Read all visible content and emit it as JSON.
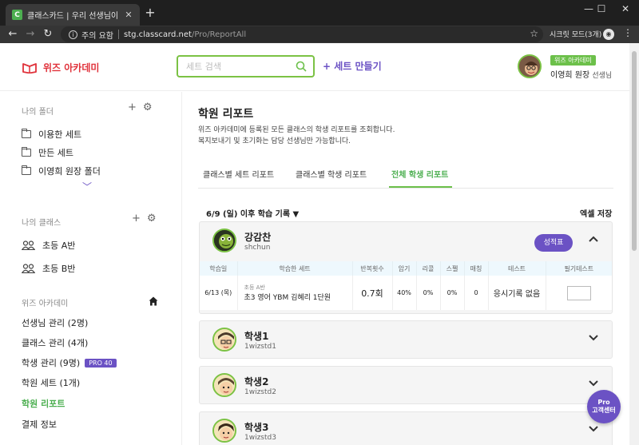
{
  "browser": {
    "tab_title": "클래스카드 | 우리 선생님이 만든",
    "warning": "주의 요함",
    "url_host": "stg.classcard.net",
    "url_path": "/Pro/ReportAll",
    "incognito_label": "시크릿 모드(3개)"
  },
  "header": {
    "logo": "위즈 아카데미",
    "search_placeholder": "세트 검색",
    "create_set": "+ 세트 만들기",
    "org_badge": "위즈 아카데미",
    "user_name": "이영희 원장",
    "user_role": "선생님"
  },
  "sidebar": {
    "folders_title": "나의 폴더",
    "folders": [
      "이용한 세트",
      "만든 세트",
      "이영희 원장 폴더"
    ],
    "classes_title": "나의 클래스",
    "classes": [
      "초등 A반",
      "초등 B반"
    ],
    "academy_title": "위즈 아카데미",
    "menu": [
      {
        "label": "선생님 관리 (2명)"
      },
      {
        "label": "클래스 관리 (4개)"
      },
      {
        "label": "학생 관리 (9명)",
        "badge": "PRO 40"
      },
      {
        "label": "학원 세트 (1개)"
      },
      {
        "label": "학원 리포트"
      },
      {
        "label": "결제 정보"
      }
    ]
  },
  "main": {
    "title": "학원 리포트",
    "desc1": "위즈 아카데미에 등록된 모든 클래스의 학생 리포트를 조회합니다.",
    "desc2": "복지보내기 및 초기화는 담당 선생님만 가능합니다.",
    "tabs": [
      "클래스별 세트 리포트",
      "클래스별 학생 리포트",
      "전체 학생 리포트"
    ],
    "record_filter": "6/9 (일) 이후 학습 기록 ▼",
    "excel_save": "엑셀 저장"
  },
  "students": [
    {
      "name": "강감찬",
      "id": "shchun",
      "report_button": "성적표",
      "table": {
        "headers": [
          "학습일",
          "학습한 세트",
          "반복횟수",
          "암기",
          "리콜",
          "스펠",
          "매칭",
          "테스트",
          "필기테스트"
        ],
        "row": {
          "date": "6/13 (목)",
          "set_class": "초등 A반",
          "set_name": "초3 영어 YBM 김혜리 1단원",
          "repeat": "0.7회",
          "memorize": "40%",
          "recall": "0%",
          "spell": "0%",
          "matching": "0",
          "test": "응시기록 없음"
        }
      }
    },
    {
      "name": "학생1",
      "id": "1wizstd1"
    },
    {
      "name": "학생2",
      "id": "1wizstd2"
    },
    {
      "name": "학생3",
      "id": "1wizstd3"
    }
  ],
  "fab": {
    "line1": "Pro",
    "line2": "고객센터"
  },
  "colors": {
    "brand_red": "#e0313a",
    "accent_purple": "#6b52c4",
    "accent_green": "#6cc04a"
  }
}
